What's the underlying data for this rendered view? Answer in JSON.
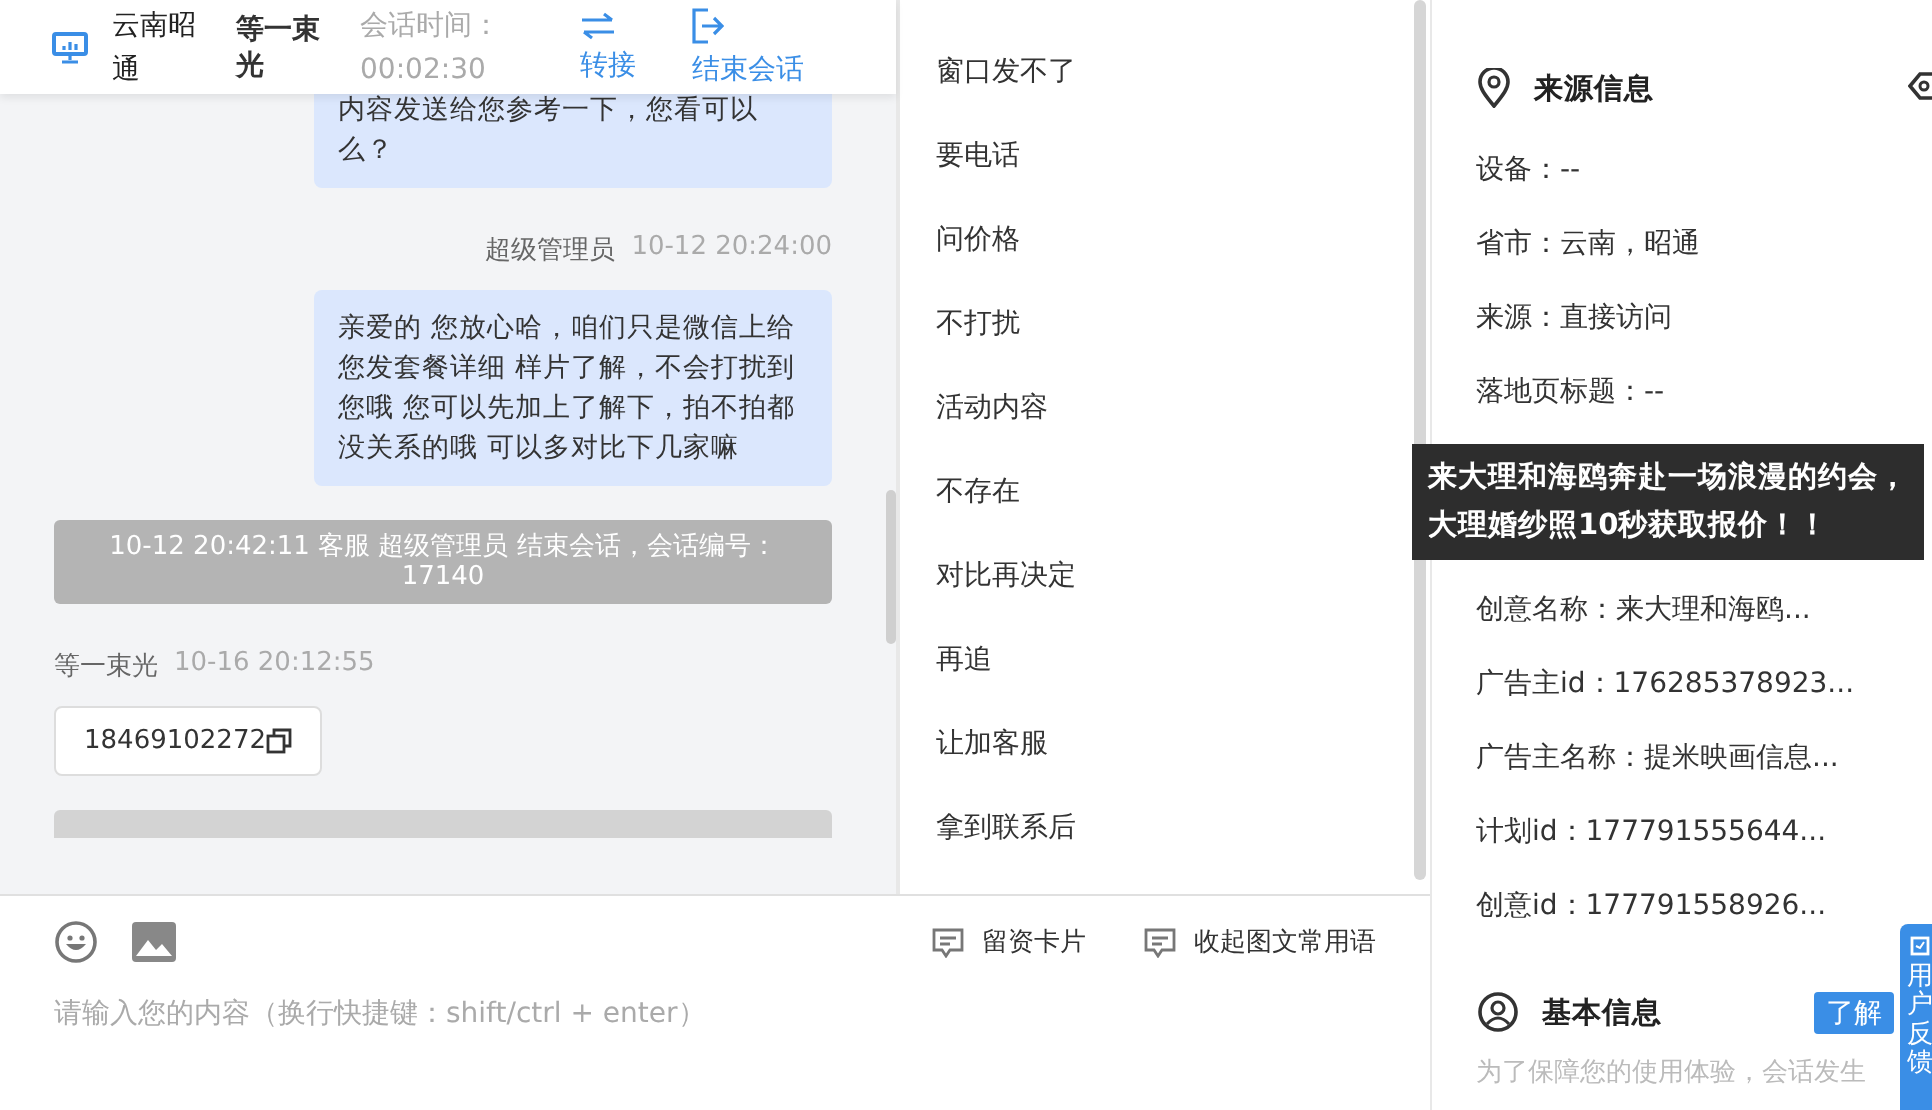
{
  "header": {
    "region": "云南昭通",
    "visitor": "等一束光",
    "time_label": "会话时间：",
    "time_value": "00:02:30",
    "actions": [
      {
        "kind": "transfer",
        "label": "转接"
      },
      {
        "kind": "end",
        "label": "结束会话"
      }
    ]
  },
  "messages": [
    {
      "kind": "agent",
      "text": "内容发送给您参考一下，您看可以么？"
    },
    {
      "kind": "agent",
      "sender": "超级管理员",
      "time": "10-12 20:24:00",
      "text": "亲爱的 您放心哈，咱们只是微信上给您发套餐详细 样片了解，不会打扰到您哦 您可以先加上了解下，拍不拍都没关系的哦 可以多对比下几家嘛"
    },
    {
      "kind": "system",
      "text": "10-12 20:42:11 客服 超级管理员 结束会话，会话编号：17140"
    },
    {
      "kind": "visitor",
      "sender": "等一束光",
      "time": "10-16 20:12:55",
      "text": "18469102272"
    },
    {
      "kind": "system_cut"
    }
  ],
  "phrases": [
    "窗口发不了",
    "要电话",
    "问价格",
    "不打扰",
    "活动内容",
    "不存在",
    "对比再决定",
    "再追",
    "让加客服",
    "拿到联系后"
  ],
  "toolbar": [
    {
      "kind": "emoji"
    },
    {
      "kind": "image"
    },
    {
      "kind": "card",
      "label": "留资卡片"
    },
    {
      "kind": "collapse",
      "label": "收起图文常用语"
    }
  ],
  "input": {
    "placeholder": "请输入您的内容（换行快捷键：shift/ctrl + enter）"
  },
  "source_info": {
    "title": "来源信息",
    "rows": [
      {
        "text": "设备：--"
      },
      {
        "text": "省市：云南，昭通"
      },
      {
        "text": "来源：直接访问"
      },
      {
        "text": "落地页标题：--"
      },
      {
        "kind": "tooltip",
        "text": "来大理和海鸥奔赴一场浪漫的约会，大理婚纱照10秒获取报价！！"
      },
      {
        "text": "创意名称：来大理和海鸥..."
      },
      {
        "text": "广告主id：176285378923..."
      },
      {
        "text": "广告主名称：提米映画信息..."
      },
      {
        "text": "计划id：177791555644..."
      },
      {
        "text": "创意id：177791558926..."
      }
    ]
  },
  "basic_info": {
    "title": "基本信息",
    "button": "了解",
    "note": "为了保障您的使用体验，会话发生"
  },
  "feedback": {
    "label": "用户反馈"
  }
}
